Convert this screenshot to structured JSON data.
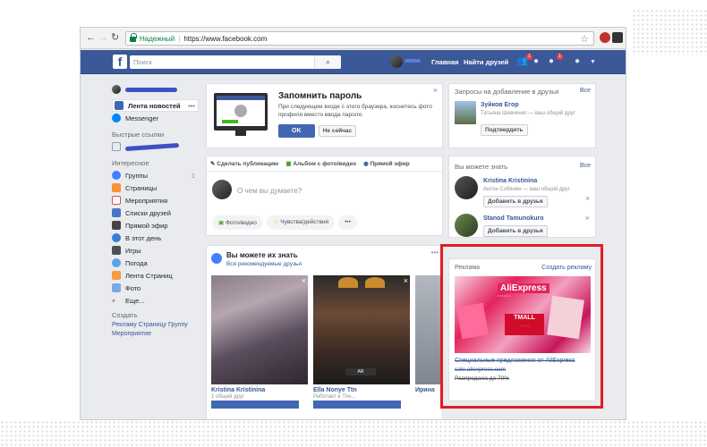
{
  "browser": {
    "secure_label": "Надежный",
    "url": "https://www.facebook.com"
  },
  "topbar": {
    "search_placeholder": "Поиск",
    "home": "Главная",
    "find_friends": "Найти друзей",
    "badge_friends": "1",
    "badge_notifications": "1",
    "accent": "#3b5998"
  },
  "left": {
    "news_feed": "Лента новостей",
    "messenger": "Messenger",
    "shortcuts_heading": "Быстрые ссылки",
    "interests_heading": "Интересное",
    "items": [
      "Группы",
      "Страницы",
      "Мероприятия",
      "Списки друзей",
      "Прямой эфир",
      "В этот день",
      "Игры",
      "Погода",
      "Лента Страниц",
      "Фото"
    ],
    "groups_count": "1",
    "more": "Еще...",
    "create_heading": "Создать",
    "create": [
      "Рекламу",
      "Страницу",
      "Группу",
      "Мероприятие"
    ]
  },
  "remember": {
    "title": "Запомнить пароль",
    "desc": "При следующем входе с этого браузера, коснитесь фото профиля вместо ввода пароля.",
    "ok": "OK",
    "not_now": "Не сейчас"
  },
  "composer": {
    "tabs": [
      "Сделать публикацию",
      "Альбом с фото/видео",
      "Прямой эфир"
    ],
    "placeholder": "О чем вы думаете?",
    "actions": [
      "Фото/видео",
      "Чувства/действия"
    ]
  },
  "pymk": {
    "title": "Вы можете их знать",
    "see_all": "Вся рекомендуемые друзья",
    "people": [
      {
        "name": "Kristina Kristinina",
        "sub": "1 общий друг"
      },
      {
        "name": "Ella Nonye Ttn",
        "sub": "Работает в The..."
      },
      {
        "name": "Ирина",
        "sub": ""
      }
    ]
  },
  "requests": {
    "title": "Запросы на добавление в друзья",
    "see_all": "Все",
    "name": "Зуйков Егор",
    "mutual": "Татьяна Шевченко — ваш общий друг",
    "confirm": "Подтвердить"
  },
  "pymk_side": {
    "title": "Вы можете знать",
    "see_all": "Все",
    "people": [
      {
        "name": "Kristina Kristinina",
        "mutual": "Антон Собянин — ваш общий друг"
      },
      {
        "name": "Stanod Tamunokuro",
        "mutual": ""
      }
    ],
    "add": "Добавить в друзья"
  },
  "ads": {
    "title": "Реклама",
    "create": "Создать рекламу",
    "brand": "AliExpress",
    "tmall": "TMALL",
    "headline": "Специальные предложения от AliExpress",
    "url": "sale.aliexpress.com",
    "desc": "Распродажа до 70%",
    "highlight_color": "#e31b23"
  }
}
